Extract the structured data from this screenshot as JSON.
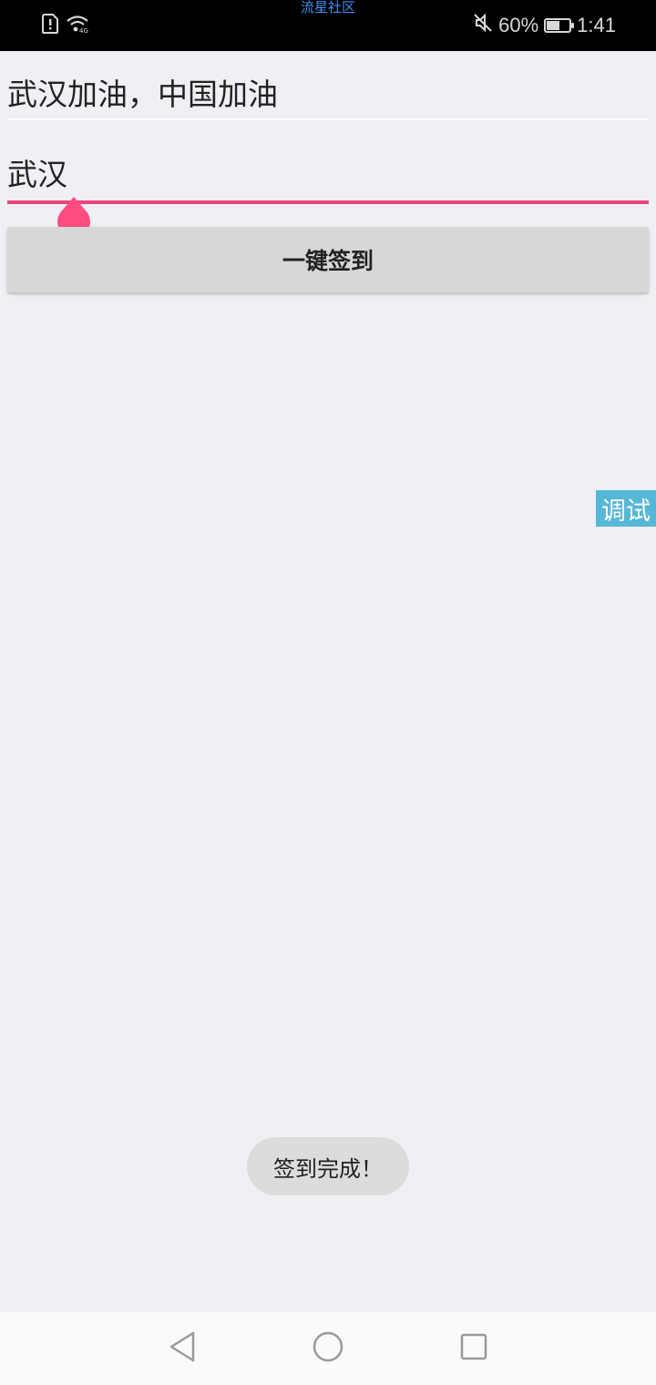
{
  "status_bar": {
    "app_label": "流星社区",
    "battery_percent_text": "60%",
    "battery_level": 0.6,
    "time": "1:41",
    "icons": [
      "sim-alert-icon",
      "wifi-icon",
      "mute-icon",
      "battery-icon"
    ]
  },
  "form": {
    "field1_value": "武汉加油，中国加油",
    "field2_value": "武汉",
    "field2_accent_color": "#e8467a",
    "sign_button_label": "一键签到"
  },
  "debug_tab_label": "调试",
  "toast_message": "签到完成！",
  "nav_bar": {
    "icons": [
      "back-icon",
      "home-icon",
      "recent-apps-icon"
    ]
  }
}
